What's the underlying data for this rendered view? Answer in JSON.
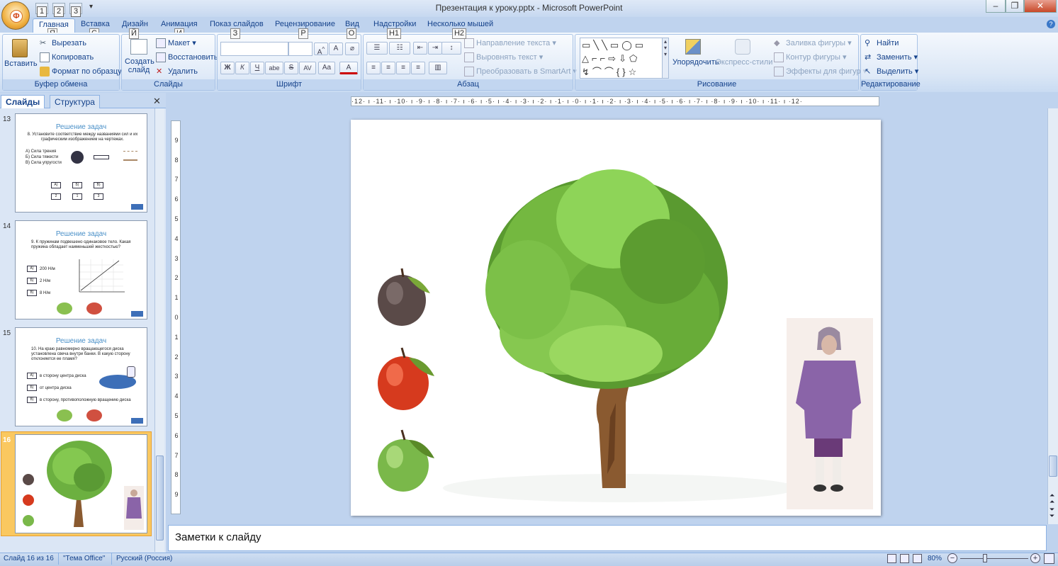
{
  "window": {
    "title": "Презентация к уроку.pptx - Microsoft PowerPoint",
    "office_letter": "Ф",
    "qat_keytips": [
      "1",
      "2",
      "3"
    ]
  },
  "tabs": [
    {
      "label": "Главная",
      "keytip": "Я"
    },
    {
      "label": "Вставка",
      "keytip": "С"
    },
    {
      "label": "Дизайн",
      "keytip": "Й"
    },
    {
      "label": "Анимация",
      "keytip": "И"
    },
    {
      "label": "Показ слайдов",
      "keytip": "З"
    },
    {
      "label": "Рецензирование",
      "keytip": "Р"
    },
    {
      "label": "Вид",
      "keytip": "О"
    },
    {
      "label": "Надстройки",
      "keytip": "Н1"
    },
    {
      "label": "Несколько мышей",
      "keytip": "Н2"
    }
  ],
  "ribbon": {
    "clipboard": {
      "label": "Буфер обмена",
      "paste": "Вставить",
      "cut": "Вырезать",
      "copy": "Копировать",
      "format_painter": "Формат по образцу"
    },
    "slides": {
      "label": "Слайды",
      "new_slide": "Создать слайд",
      "layout": "Макет",
      "reset": "Восстановить",
      "delete": "Удалить"
    },
    "font": {
      "label": "Шрифт",
      "bold": "Ж",
      "italic": "К",
      "underline": "Ч",
      "shadow": "abe",
      "strike": "S",
      "spacing": "AV",
      "case": "Aa",
      "color": "A"
    },
    "paragraph": {
      "label": "Абзац",
      "text_direction": "Направление текста",
      "align_text": "Выровнять текст",
      "smartart": "Преобразовать в SmartArt"
    },
    "drawing": {
      "label": "Рисование",
      "arrange": "Упорядочить",
      "quick_styles": "Экспресс-стили",
      "fill": "Заливка фигуры",
      "outline": "Контур фигуры",
      "effects": "Эффекты для фигур"
    },
    "editing": {
      "label": "Редактирование",
      "find": "Найти",
      "replace": "Заменить",
      "select": "Выделить"
    }
  },
  "pane": {
    "tab_slides": "Слайды",
    "tab_outline": "Структура"
  },
  "thumbnails": [
    {
      "num": "13",
      "title": "Решение задач",
      "text": "8. Установите соответствие между названиями сил и их графическим изображением на чертежах.",
      "options": [
        "А) Сила трения",
        "Б) Сила тяжести",
        "В) Сила упругости"
      ],
      "answers": [
        "А)",
        "Б)",
        "В)"
      ],
      "values": [
        "2",
        "1",
        "3"
      ]
    },
    {
      "num": "14",
      "title": "Решение задач",
      "text": "9. К пружинам подвешено одинаковое тело. Какая пружина обладает наименьшей жесткостью?",
      "options": [
        "200 Н/м",
        "2 Н/м",
        "8 Н/м"
      ],
      "labels": [
        "А)",
        "Б)",
        "В)"
      ]
    },
    {
      "num": "15",
      "title": "Решение задач",
      "text": "10. На краю равномерно вращающегося диска установлена свеча внутри банки. В какую сторону отклоняется ее пламя?",
      "options": [
        "в сторону центра диска",
        "от центра диска",
        "в сторону, противоположную вращению диска"
      ],
      "labels": [
        "А)",
        "Б)",
        "В)"
      ]
    },
    {
      "num": "16"
    }
  ],
  "hruler": "·12· ı ·11· ı ·10· ı ·9· ı ·8· ı ·7· ı ·6· ı ·5· ı ·4· ı ·3· ı ·2· ı ·1· ı ·0· ı ·1· ı ·2· ı ·3· ı ·4· ı ·5· ı ·6· ı ·7· ı ·8· ı ·9· ı ·10· ı ·11· ı ·12·",
  "vruler": [
    "9",
    "8",
    "7",
    "6",
    "5",
    "4",
    "3",
    "2",
    "1",
    "0",
    "1",
    "2",
    "3",
    "4",
    "5",
    "6",
    "7",
    "8",
    "9"
  ],
  "notes": {
    "placeholder": "Заметки к слайду"
  },
  "status": {
    "slide": "Слайд 16 из 16",
    "theme": "\"Тема Office\"",
    "language": "Русский (Россия)",
    "zoom": "80%"
  },
  "colors": {
    "apple_dark": "#5a4a48",
    "apple_red": "#d63a1e",
    "apple_green": "#7ab84a",
    "coat": "#8a64a8"
  }
}
